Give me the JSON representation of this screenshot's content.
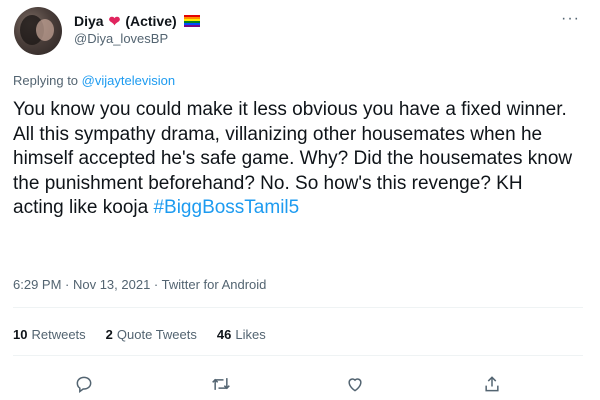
{
  "author": {
    "name": "Diya",
    "status": "(Active)",
    "handle": "@Diya_lovesBP"
  },
  "replying": {
    "prefix": "Replying to",
    "target": "@vijaytelevision"
  },
  "tweet": {
    "text": "You know you could make it less obvious you have a fixed winner. All this sympathy drama, villanizing other housemates when he himself accepted he's safe game. Why? Did the housemates know the punishment beforehand? No. So how's this revenge? KH acting like kooja ",
    "hashtag": "#BiggBossTamil5"
  },
  "meta": {
    "time_date": "6:29 PM · Nov 13, 2021 ·",
    "source": "Twitter for Android"
  },
  "stats": {
    "retweets": {
      "count": "10",
      "label": "Retweets"
    },
    "quotes": {
      "count": "2",
      "label": "Quote Tweets"
    },
    "likes": {
      "count": "46",
      "label": "Likes"
    }
  },
  "icons": {
    "reply": "reply-icon",
    "retweet": "retweet-icon",
    "like": "heart-icon",
    "share": "share-icon",
    "more": "more-icon"
  },
  "colors": {
    "link": "#1d9bf0",
    "secondary_text": "#536471",
    "heart": "#e0245e"
  }
}
